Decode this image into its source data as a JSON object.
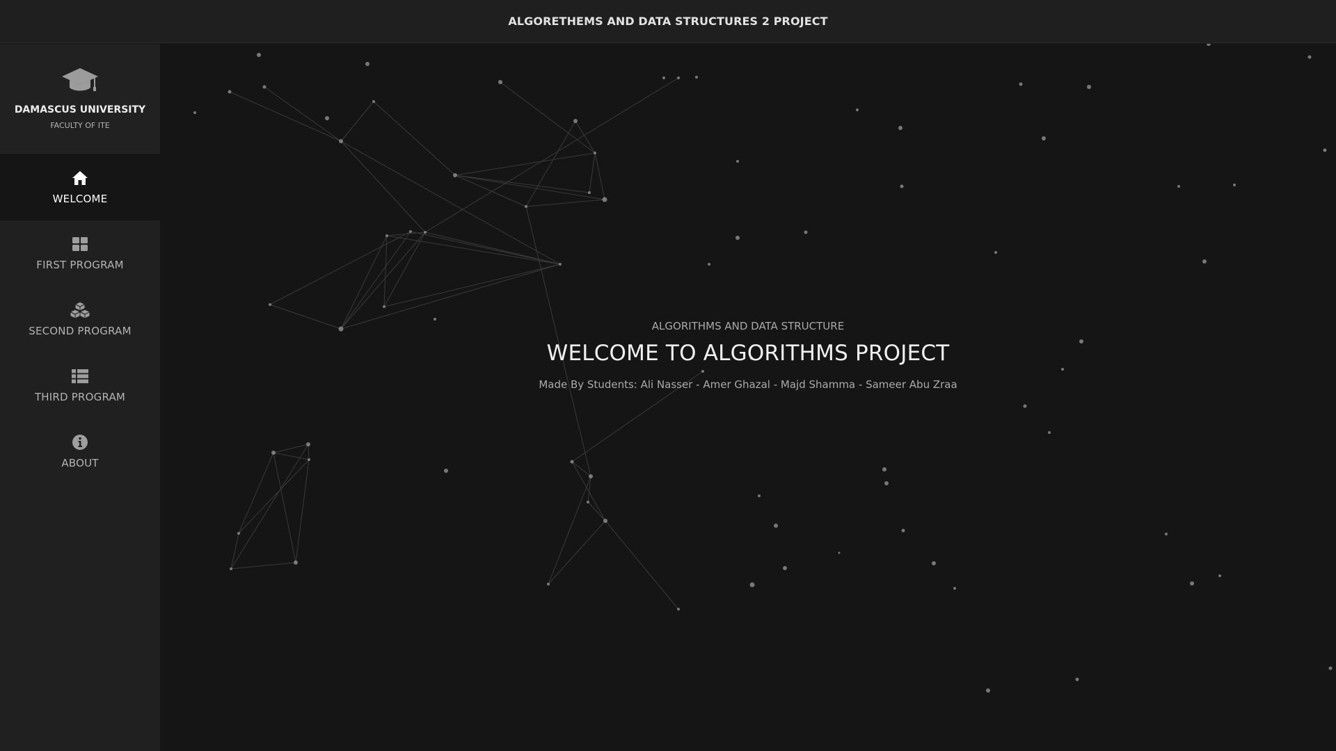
{
  "header": {
    "title": "ALGORETHEMS AND DATA STRUCTURES 2 PROJECT"
  },
  "sidebar": {
    "brand": {
      "icon": "graduation-cap-icon",
      "title": "DAMASCUS UNIVERSITY",
      "subtitle": "FACULTY OF ITE"
    },
    "items": [
      {
        "label": "WELCOME",
        "icon": "home-icon",
        "active": true
      },
      {
        "label": "FIRST PROGRAM",
        "icon": "grid-icon",
        "active": false
      },
      {
        "label": "SECOND PROGRAM",
        "icon": "cubes-icon",
        "active": false
      },
      {
        "label": "THIRD PROGRAM",
        "icon": "list-icon",
        "active": false
      },
      {
        "label": "ABOUT",
        "icon": "info-icon",
        "active": false
      }
    ]
  },
  "main": {
    "kicker": "ALGORITHMS AND DATA STRUCTURE",
    "title": "WELCOME TO ALGORITHMS PROJECT",
    "credits": "Made By Students: Ali Nasser - Amer Ghazal - Majd Shamma - Sameer Abu Zraa"
  },
  "colors": {
    "background": "#151515",
    "sidebar": "#202020",
    "topbar": "#1f1f1f",
    "particle": "#9a9a9a",
    "line": "#3a3a3a"
  }
}
